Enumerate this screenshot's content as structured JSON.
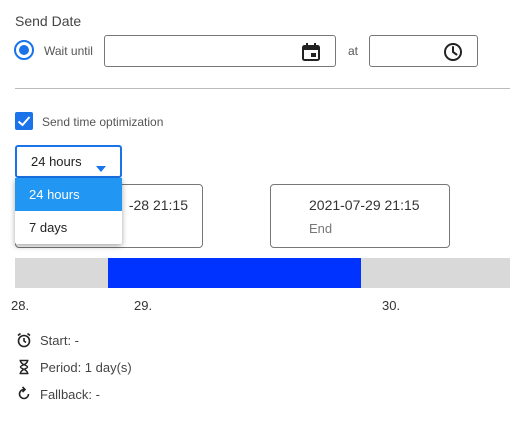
{
  "send_date": {
    "title": "Send Date",
    "wait_until_label": "Wait until",
    "date_value": "",
    "at_label": "at",
    "time_value": ""
  },
  "optimization": {
    "checkbox_label": "Send time optimization",
    "checked": true,
    "period_select": {
      "value": "24 hours",
      "options": [
        "24 hours",
        "7 days"
      ],
      "selected_index": 0
    }
  },
  "range": {
    "start": {
      "datetime": "-28 21:15",
      "label": ""
    },
    "end": {
      "datetime": "2021-07-29 21:15",
      "label": "End"
    }
  },
  "timeline": {
    "ticks": [
      "28.",
      "29.",
      "30."
    ],
    "colors": {
      "track": "#d9d9d9",
      "fill": "#0033ff"
    }
  },
  "summary": {
    "start": "Start: -",
    "period": "Period: 1 day(s)",
    "fallback": "Fallback: -"
  },
  "colors": {
    "accent": "#1a73e8",
    "dropdown_selected": "#2196f3"
  },
  "icons": {
    "date": "calendar-icon",
    "time": "clock-icon",
    "caret": "caret-down-icon",
    "start": "alarm-clock-icon",
    "period": "hourglass-icon",
    "fallback": "refresh-icon"
  }
}
